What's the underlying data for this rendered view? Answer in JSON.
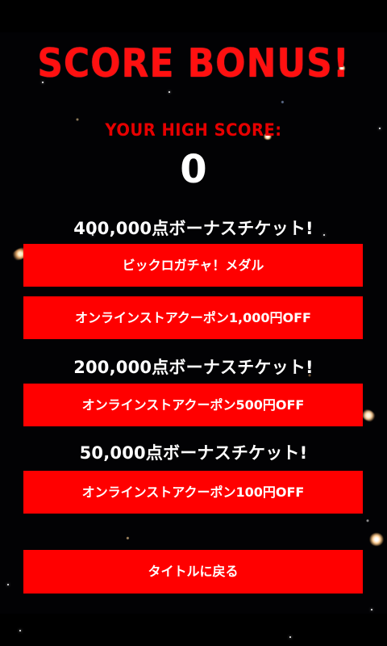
{
  "header": {
    "title": "SCORE BONUS!",
    "high_score_label": "YOUR HIGH SCORE:",
    "high_score_value": "0"
  },
  "sections": [
    {
      "title": "400,000点ボーナスチケット!",
      "buttons": [
        {
          "label": "ビックロガチャ！メダル"
        },
        {
          "label": "オンラインストアクーポン1,000円OFF"
        }
      ]
    },
    {
      "title": "200,000点ボーナスチケット!",
      "buttons": [
        {
          "label": "オンラインストアクーポン500円OFF"
        }
      ]
    },
    {
      "title": "50,000点ボーナスチケット!",
      "buttons": [
        {
          "label": "オンラインストアクーポン100円OFF"
        }
      ]
    }
  ],
  "footer": {
    "back_button_label": "タイトルに戻る"
  },
  "colors": {
    "accent_red": "#ff0000",
    "title_red": "#ff1010",
    "text_white": "#ffffff",
    "background": "#000000"
  }
}
